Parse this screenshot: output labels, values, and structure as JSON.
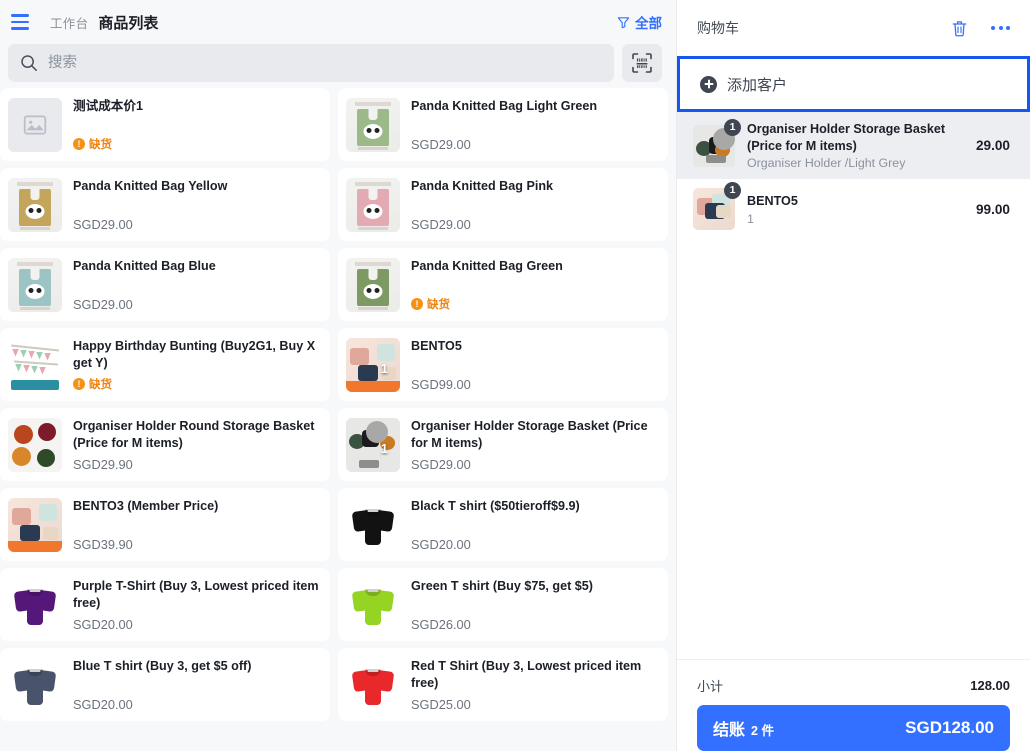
{
  "header": {
    "menu_icon": "hamburger-menu-icon",
    "breadcrumb_root": "工作台",
    "breadcrumb_current": "商品列表",
    "filter_icon": "filter-icon",
    "filter_label": "全部"
  },
  "search": {
    "icon": "search-icon",
    "placeholder": "搜索",
    "value": "",
    "scan_icon": "barcode-scan-icon"
  },
  "labels": {
    "out_of_stock": "缺货"
  },
  "colors": {
    "accent_blue": "#3370ff",
    "highlight_border": "#1456f0",
    "warning_orange": "#f08410",
    "page_bg": "#f7f8fa",
    "card_bg": "#ffffff",
    "selected_row_bg": "#eceef2"
  },
  "products": [
    {
      "name": "测试成本价1",
      "price": "",
      "out_of_stock": true,
      "art": "placeholder",
      "qty_badge": ""
    },
    {
      "name": "Panda Knitted Bag Light Green",
      "price": "SGD29.00",
      "out_of_stock": false,
      "art": "bag",
      "color": "#9cb98a",
      "qty_badge": ""
    },
    {
      "name": "Panda Knitted Bag Yellow",
      "price": "SGD29.00",
      "out_of_stock": false,
      "art": "bag",
      "color": "#c3a55c",
      "qty_badge": ""
    },
    {
      "name": "Panda Knitted Bag Pink",
      "price": "SGD29.00",
      "out_of_stock": false,
      "art": "bag",
      "color": "#e4aab4",
      "qty_badge": ""
    },
    {
      "name": "Panda Knitted Bag Blue",
      "price": "SGD29.00",
      "out_of_stock": false,
      "art": "bag",
      "color": "#9dc4c4",
      "qty_badge": ""
    },
    {
      "name": "Panda Knitted Bag Green",
      "price": "",
      "out_of_stock": true,
      "art": "bag",
      "color": "#7d9a62",
      "qty_badge": ""
    },
    {
      "name": "Happy Birthday Bunting (Buy2G1, Buy X get Y)",
      "price": "",
      "out_of_stock": true,
      "art": "bunting",
      "qty_badge": ""
    },
    {
      "name": "BENTO5",
      "price": "SGD99.00",
      "out_of_stock": false,
      "art": "bento",
      "qty_badge": "1"
    },
    {
      "name": "Organiser Holder Round Storage Basket (Price for M items)",
      "price": "SGD29.90",
      "out_of_stock": false,
      "art": "bowls",
      "qty_badge": ""
    },
    {
      "name": "Organiser Holder Storage Basket (Price for M items)",
      "price": "SGD29.00",
      "out_of_stock": false,
      "art": "bowls2",
      "qty_badge": "1"
    },
    {
      "name": "BENTO3 (Member Price)",
      "price": "SGD39.90",
      "out_of_stock": false,
      "art": "bento3",
      "qty_badge": ""
    },
    {
      "name": "Black T shirt ($50tieroff$9.9)",
      "price": "SGD20.00",
      "out_of_stock": false,
      "art": "tee",
      "color": "#121212",
      "qty_badge": ""
    },
    {
      "name": "Purple T-Shirt (Buy 3, Lowest priced item free)",
      "price": "SGD20.00",
      "out_of_stock": false,
      "art": "tee",
      "color": "#55177a",
      "qty_badge": ""
    },
    {
      "name": "Green T shirt (Buy $75, get $5)",
      "price": "SGD26.00",
      "out_of_stock": false,
      "art": "tee",
      "color": "#96d424",
      "qty_badge": ""
    },
    {
      "name": "Blue T shirt (Buy 3, get $5 off)",
      "price": "SGD20.00",
      "out_of_stock": false,
      "art": "tee",
      "color": "#49536b",
      "qty_badge": ""
    },
    {
      "name": "Red T Shirt (Buy 3, Lowest priced item free)",
      "price": "SGD25.00",
      "out_of_stock": false,
      "art": "tee",
      "color": "#e8282a",
      "qty_badge": ""
    }
  ],
  "cart": {
    "title": "购物车",
    "delete_icon": "trash-icon",
    "more_icon": "more-options-icon",
    "add_customer": {
      "icon": "add-circle-icon",
      "label": "添加客户"
    },
    "items": [
      {
        "name": "Organiser Holder Storage Basket (Price for M items)",
        "variant": "Organiser Holder /Light Grey",
        "qty": "1",
        "amount": "29.00",
        "selected": true,
        "art": "bowls2"
      },
      {
        "name": "BENTO5",
        "variant": "1",
        "qty": "1",
        "amount": "99.00",
        "selected": false,
        "art": "bento"
      }
    ],
    "subtotal_label": "小计",
    "subtotal_value": "128.00",
    "checkout_label": "结账",
    "checkout_count": "2 件",
    "checkout_total": "SGD128.00"
  }
}
